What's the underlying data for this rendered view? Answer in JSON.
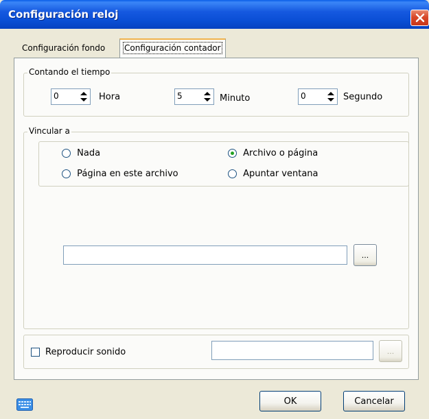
{
  "window": {
    "title": "Configuración reloj"
  },
  "tabs": [
    {
      "label": "Configuración fondo",
      "active": false
    },
    {
      "label": "Configuración contador",
      "active": true
    }
  ],
  "countdown": {
    "group_label": "Contando el tiempo",
    "hours": {
      "value": "0",
      "label": "Hora"
    },
    "minutes": {
      "value": "5",
      "label": "Minuto"
    },
    "seconds": {
      "value": "0",
      "label": "Segundo"
    }
  },
  "link": {
    "group_label": "Vincular a",
    "options": [
      {
        "label": "Nada",
        "checked": false
      },
      {
        "label": "Archivo o página",
        "checked": true
      },
      {
        "label": "Página en este archivo",
        "checked": false
      },
      {
        "label": "Apuntar ventana",
        "checked": false
      }
    ],
    "path_value": "",
    "browse_label": "..."
  },
  "sound": {
    "checkbox_label": "Reproducir sonido",
    "checked": false,
    "path_value": "",
    "browse_label": "..."
  },
  "buttons": {
    "ok": "OK",
    "cancel": "Cancelar"
  },
  "colors": {
    "titlebar": "#0a4fd6",
    "dialog_bg": "#ece9d8",
    "panel_bg": "#fbfbf9",
    "close_button": "#d8482a"
  },
  "icons": {
    "close": "close-icon",
    "keyboard": "keyboard-icon"
  }
}
